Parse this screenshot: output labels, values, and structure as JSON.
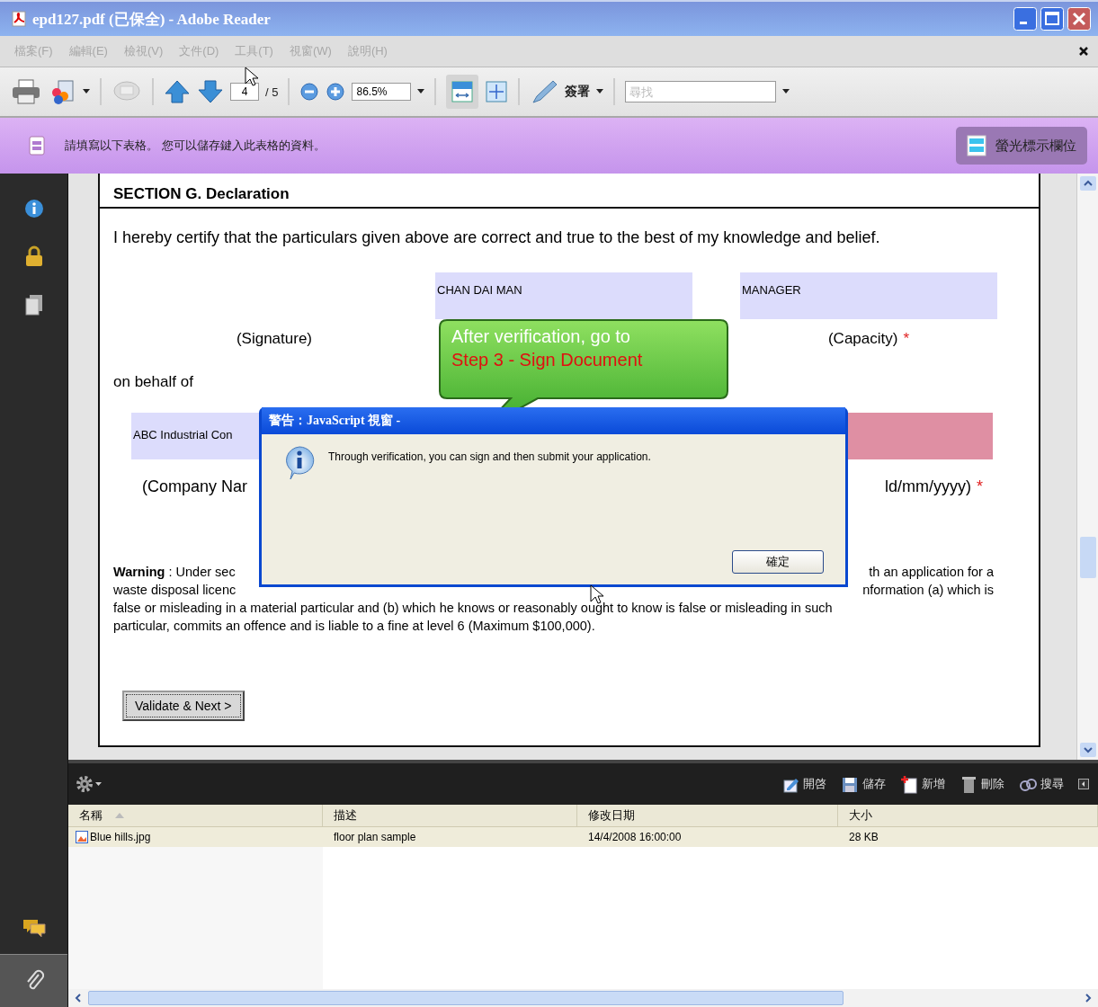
{
  "window": {
    "title": "epd127.pdf (已保全) - Adobe Reader"
  },
  "menu": [
    {
      "label": "檔案(F)",
      "disabled": true
    },
    {
      "label": "編輯(E)",
      "disabled": true
    },
    {
      "label": "檢視(V)",
      "disabled": true
    },
    {
      "label": "文件(D)",
      "disabled": true
    },
    {
      "label": "工具(T)",
      "disabled": true
    },
    {
      "label": "視窗(W)",
      "disabled": true
    },
    {
      "label": "說明(H)",
      "disabled": true
    }
  ],
  "toolbar": {
    "page_number": "4",
    "page_total": "/ 5",
    "zoom": "86.5%",
    "sign": "簽署",
    "search_placeholder": "尋找"
  },
  "form_bar": {
    "message": "請填寫以下表格。 您可以儲存鍵入此表格的資料。",
    "highlight_button": "螢光標示欄位"
  },
  "document": {
    "section_title": "SECTION G. Declaration",
    "certify": "I hereby certify that the particulars given above are correct and true to the best of my knowledge and belief.",
    "name_field": "CHAN DAI MAN",
    "capacity_field": "MANAGER",
    "signature_label": "(Signature)",
    "capacity_label": "(Capacity)",
    "required_mark": "*",
    "on_behalf": "on behalf of",
    "company_field": "ABC Industrial Con",
    "company_label": "(Company Nar",
    "date_label": "ld/mm/yyyy)",
    "date_required_mark": "*",
    "warning_lines": [
      {
        "left": "**Warning** : Under sec",
        "right": "th an application for a"
      },
      {
        "left": "waste disposal licenc",
        "right": "nformation (a) which is"
      },
      {
        "left": "false or misleading in a material particular and (b) which he knows or reasonably ought to know is false or misleading in such"
      },
      {
        "left": "particular, commits an offence and is liable to a fine at level 6 (Maximum $100,000)."
      }
    ],
    "validate_button": "Validate & Next >"
  },
  "callout": {
    "line_1": "After verification, go to",
    "line_2": "Step 3 - Sign Document"
  },
  "dialog": {
    "title": "警告：JavaScript 視窗 -",
    "message": "Through verification, you can sign and then submit your application.",
    "ok": "確定"
  },
  "attachments": {
    "actions": [
      {
        "label": "開啓",
        "kind": "open"
      },
      {
        "label": "儲存",
        "kind": "save"
      },
      {
        "label": "新增",
        "kind": "add"
      },
      {
        "label": "刪除",
        "kind": "delete"
      },
      {
        "label": "搜尋",
        "kind": "search"
      }
    ],
    "columns": [
      {
        "label": "名稱",
        "sorted": true
      },
      {
        "label": "描述",
        "sorted": false
      },
      {
        "label": "修改日期",
        "sorted": false
      },
      {
        "label": "大小",
        "sorted": false
      }
    ],
    "rows": [
      {
        "selected": true,
        "cells": [
          "Blue hills.jpg",
          "floor plan sample",
          "14/4/2008 16:00:00",
          "28 KB"
        ]
      }
    ]
  }
}
